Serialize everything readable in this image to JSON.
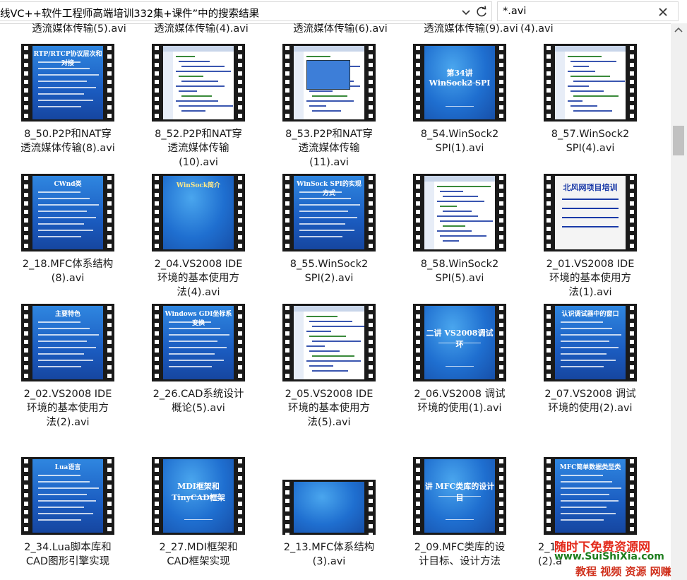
{
  "address_bar": {
    "path": "线VC++软件工程师高端培训332集+课件”中的搜索结果"
  },
  "search": {
    "value": "*.avi"
  },
  "top_row_cut": [
    "透流媒体传输(5).avi",
    "透流媒体传输(4).avi",
    "透流媒体传输(6).avi",
    "透流媒体传输(9).avi",
    "(4).avi"
  ],
  "files": [
    {
      "name": "8_50.P2P和NAT穿\n透流媒体传输(8).avi",
      "thumb_title": "RTP/RTCP协议层次和对接",
      "style": "dark"
    },
    {
      "name": "8_52.P2P和NAT穿\n透流媒体传输\n(10).avi",
      "thumb_title": "",
      "style": "code"
    },
    {
      "name": "8_53.P2P和NAT穿\n透流媒体传输\n(11).avi",
      "thumb_title": "",
      "style": "code2"
    },
    {
      "name": "8_54.WinSock2\nSPI(1).avi",
      "thumb_title": "第34讲 WinSock2 SPI",
      "style": "title"
    },
    {
      "name": "8_57.WinSock2\nSPI(4).avi",
      "thumb_title": "",
      "style": "code"
    },
    {
      "name": "2_18.MFC体系结构\n(8).avi",
      "thumb_title": "CWnd类",
      "style": "dark"
    },
    {
      "name": "2_04.VS2008 IDE\n环境的基本使用方\n法(4).avi",
      "thumb_title": "WinSock简介",
      "style": "blank"
    },
    {
      "name": "8_55.WinSock2\nSPI(2).avi",
      "thumb_title": "WinSock SPI的实现方式",
      "style": "dark"
    },
    {
      "name": "8_58.WinSock2\nSPI(5).avi",
      "thumb_title": "",
      "style": "code"
    },
    {
      "name": "2_01.VS2008 IDE\n环境的基本使用方\n法(1).avi",
      "thumb_title": "北风网项目培训",
      "style": "white"
    },
    {
      "name": "2_02.VS2008 IDE\n环境的基本使用方\n法(2).avi",
      "thumb_title": "主要特色",
      "style": "dark"
    },
    {
      "name": "2_26.CAD系统设计\n概论(5).avi",
      "thumb_title": "Windows GDI坐标系变换",
      "style": "dark"
    },
    {
      "name": "2_05.VS2008 IDE\n环境的基本使用方\n法(5).avi",
      "thumb_title": "",
      "style": "code"
    },
    {
      "name": "2_06.VS2008 调试\n环境的使用(1).avi",
      "thumb_title": "二讲 VS2008调试环",
      "style": "title"
    },
    {
      "name": "2_07.VS2008 调试\n环境的使用(2).avi",
      "thumb_title": "认识调试器中的窗口",
      "style": "dark"
    },
    {
      "name": "2_34.Lua脚本库和\nCAD图形引擎实现",
      "thumb_title": "Lua语言",
      "style": "dark"
    },
    {
      "name": "2_27.MDI框架和\nCAD框架实现",
      "thumb_title": "MDI框架和TinyCAD框架",
      "style": "title"
    },
    {
      "name": "2_13.MFC体系结构\n(3).avi",
      "thumb_title": "",
      "style": "blank"
    },
    {
      "name": "2_09.MFC类库的设\n计目标、设计方法",
      "thumb_title": "讲 MFC类库的设计目",
      "style": "title"
    },
    {
      "name": "2_1\n(2).a",
      "thumb_title": "MFC简单数据类型类",
      "style": "dark"
    }
  ],
  "watermark": {
    "line1": "随时下免费资源网",
    "line2": "www.SuiShiXia.com",
    "line3": "教程 视频 资源 网赚"
  }
}
